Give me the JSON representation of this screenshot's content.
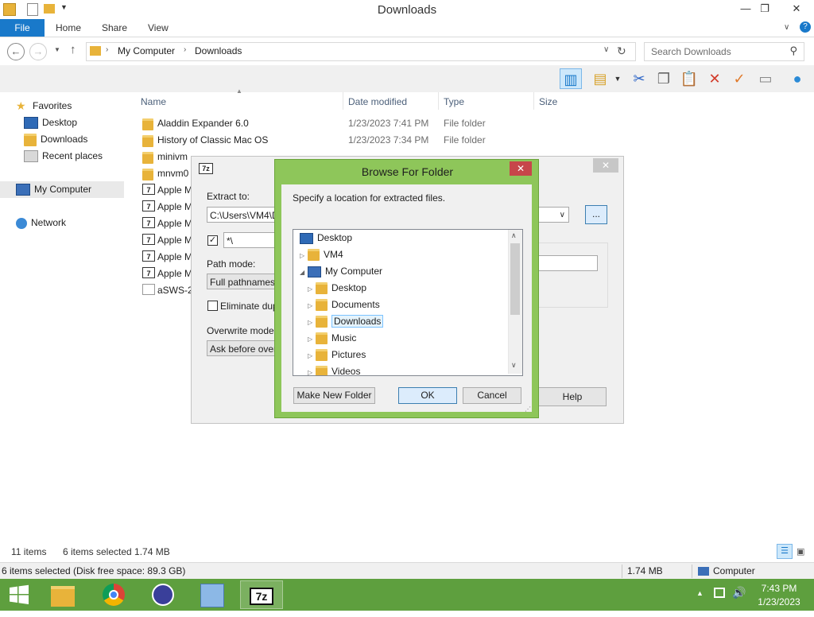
{
  "window": {
    "title": "Downloads",
    "minimize": "—",
    "maximize": "❐",
    "close": "✕"
  },
  "ribbon": {
    "tabs": [
      "File",
      "Home",
      "Share",
      "View"
    ],
    "help": "?"
  },
  "address": {
    "path": [
      "My Computer",
      "Downloads"
    ],
    "search_placeholder": "Search Downloads"
  },
  "nav": {
    "favorites": "Favorites",
    "desktop": "Desktop",
    "downloads": "Downloads",
    "recent": "Recent places",
    "computer": "My Computer",
    "network": "Network"
  },
  "columns": {
    "name": "Name",
    "date": "Date modified",
    "type": "Type",
    "size": "Size"
  },
  "files": [
    {
      "name": "Aladdin Expander 6.0",
      "date": "1/23/2023 7:41 PM",
      "type": "File folder",
      "icon": "folder"
    },
    {
      "name": "History of Classic Mac OS",
      "date": "1/23/2023 7:34 PM",
      "type": "File folder",
      "icon": "folder"
    },
    {
      "name": "minivm",
      "date": "",
      "type": "",
      "icon": "folder"
    },
    {
      "name": "mnvm0",
      "date": "",
      "type": "",
      "icon": "folder"
    },
    {
      "name": "Apple M",
      "date": "",
      "type": "",
      "icon": "7z"
    },
    {
      "name": "Apple M",
      "date": "",
      "type": "",
      "icon": "7z"
    },
    {
      "name": "Apple M",
      "date": "",
      "type": "",
      "icon": "7z"
    },
    {
      "name": "Apple M",
      "date": "",
      "type": "",
      "icon": "7z"
    },
    {
      "name": "Apple M",
      "date": "",
      "type": "",
      "icon": "7z"
    },
    {
      "name": "Apple M",
      "date": "",
      "type": "",
      "icon": "7z"
    },
    {
      "name": "aSWS-2",
      "date": "",
      "type": "",
      "icon": "doc"
    }
  ],
  "status": {
    "items": "11 items",
    "selected": "6 items selected  1.74 MB",
    "disk": "6 items selected (Disk free space: 89.3 GB)",
    "size": "1.74 MB",
    "computer": "Computer"
  },
  "extract": {
    "icon_label": "7z",
    "extract_to": "Extract to:",
    "path": "C:\\Users\\VM4\\D",
    "path_browse": "...",
    "subfolder": "*\\",
    "path_mode_label": "Path mode:",
    "path_mode": "Full pathnames",
    "eliminate": "Eliminate duplic",
    "overwrite_label": "Overwrite mode:",
    "overwrite": "Ask before overw",
    "help": "Help",
    "close": "✕"
  },
  "browse": {
    "title": "Browse For Folder",
    "close": "✕",
    "instruction": "Specify a location for extracted files.",
    "tree": [
      "Desktop",
      "VM4",
      "My Computer",
      "Desktop",
      "Documents",
      "Downloads",
      "Music",
      "Pictures",
      "Videos"
    ],
    "new_folder": "Make New Folder",
    "ok": "OK",
    "cancel": "Cancel"
  },
  "taskbar": {
    "time": "7:43 PM",
    "date": "1/23/2023",
    "app_7z": "7z"
  },
  "colors": {
    "accent": "#1979ca",
    "taskbar": "#5e9f3e",
    "dialog_frame": "#8ec65a",
    "close_red": "#c7464a"
  }
}
